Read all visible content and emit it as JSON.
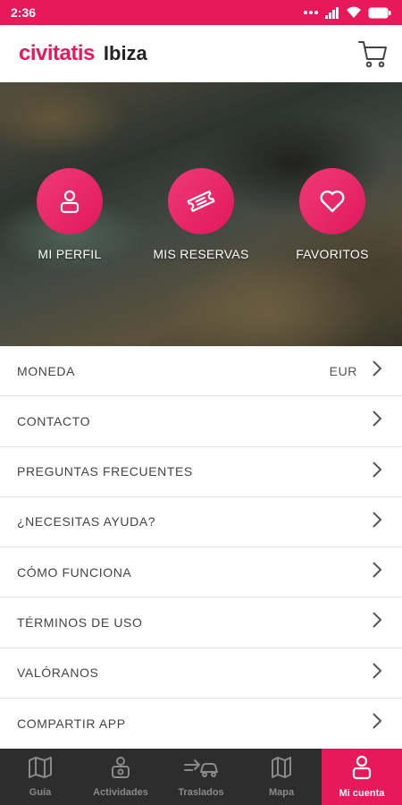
{
  "status_bar": {
    "time": "2:36"
  },
  "header": {
    "brand": "civitatis",
    "city": "Ibiza"
  },
  "hero": {
    "actions": [
      {
        "label": "MI PERFIL",
        "icon": "user-icon"
      },
      {
        "label": "MIS RESERVAS",
        "icon": "ticket-icon"
      },
      {
        "label": "FAVORITOS",
        "icon": "heart-icon"
      }
    ]
  },
  "menu": {
    "items": [
      {
        "label": "MONEDA",
        "value": "EUR"
      },
      {
        "label": "CONTACTO"
      },
      {
        "label": "PREGUNTAS FRECUENTES"
      },
      {
        "label": "¿NECESITAS AYUDA?"
      },
      {
        "label": "CÓMO FUNCIONA"
      },
      {
        "label": "TÉRMINOS DE USO"
      },
      {
        "label": "VALÓRANOS"
      },
      {
        "label": "COMPARTIR APP"
      }
    ]
  },
  "bottom_nav": {
    "items": [
      {
        "label": "Guía",
        "icon": "map-guide-icon"
      },
      {
        "label": "Actividades",
        "icon": "activities-icon"
      },
      {
        "label": "Traslados",
        "icon": "transfer-car-icon"
      },
      {
        "label": "Mapa",
        "icon": "map-icon"
      },
      {
        "label": "Mi cuenta",
        "icon": "account-icon",
        "active": true
      }
    ]
  },
  "colors": {
    "brand": "#e8195a",
    "nav_bg": "#2d2d2d"
  }
}
